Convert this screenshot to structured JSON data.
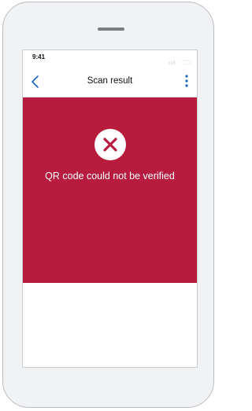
{
  "status_bar": {
    "time": "9:41"
  },
  "nav": {
    "back_icon": "chevron-left-icon",
    "title": "Scan result",
    "menu_icon": "more-vertical-icon"
  },
  "result": {
    "icon": "close-icon",
    "message": "QR code could not be verified"
  },
  "colors": {
    "accent": "#1565c0",
    "error_background": "#b71c3f",
    "icon_on_error": "#b71c3f"
  }
}
